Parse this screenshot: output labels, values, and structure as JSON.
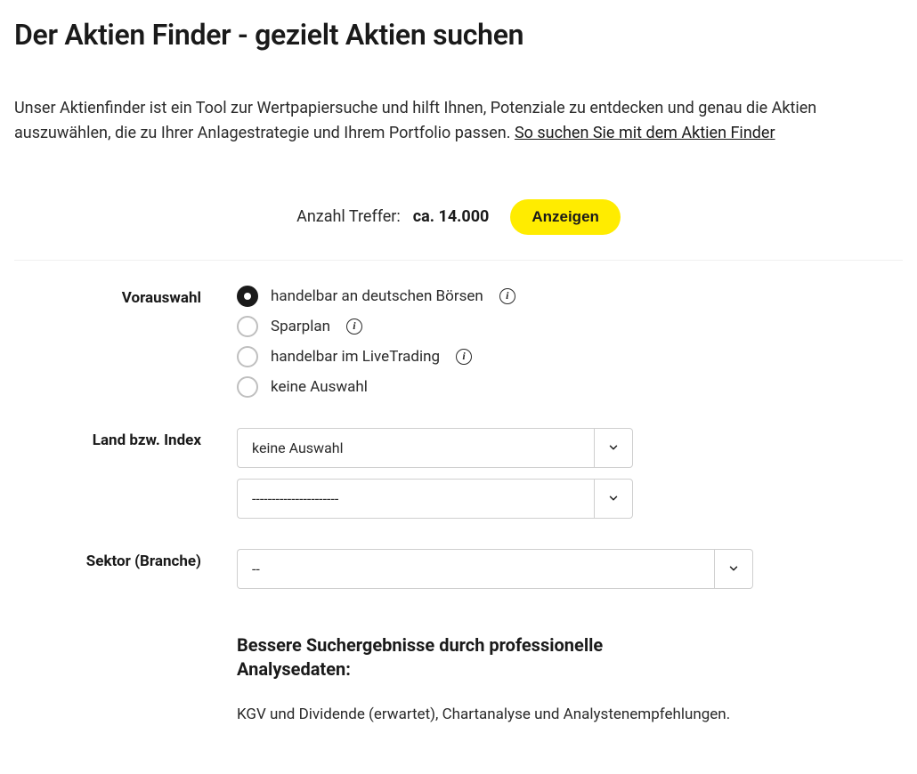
{
  "title": "Der Aktien Finder - gezielt Aktien suchen",
  "intro": {
    "text": "Unser Aktienfinder ist ein Tool zur Wertpapiersuche und hilft Ihnen, Potenziale zu entdecken und genau die Aktien auszuwählen, die zu Ihrer Anlagestrategie und Ihrem Portfolio passen. ",
    "link": "So suchen Sie mit dem Aktien Finder"
  },
  "results": {
    "label": "Anzahl Treffer:",
    "count": "ca. 14.000",
    "button": "Anzeigen"
  },
  "form": {
    "preselect": {
      "label": "Vorauswahl",
      "options": [
        {
          "label": "handelbar an deutschen Börsen",
          "info": true,
          "selected": true
        },
        {
          "label": "Sparplan",
          "info": true,
          "selected": false
        },
        {
          "label": "handelbar im LiveTrading",
          "info": true,
          "selected": false
        },
        {
          "label": "keine Auswahl",
          "info": false,
          "selected": false
        }
      ]
    },
    "country": {
      "label": "Land bzw. Index",
      "select1": "keine Auswahl",
      "select2": "----------------------"
    },
    "sector": {
      "label": "Sektor (Branche)",
      "select": "--"
    }
  },
  "footer": {
    "heading": "Bessere Suchergebnisse durch professionelle Analysedaten:",
    "text": "KGV und Dividende (erwartet), Chartanalyse und Analystenempfehlungen."
  }
}
